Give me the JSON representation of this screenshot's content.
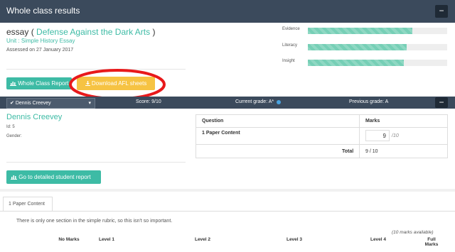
{
  "header": {
    "title": "Whole class results",
    "collapse": "−"
  },
  "assessment": {
    "type": "essay",
    "open_paren": "( ",
    "subject": "Defense Against the Dark Arts",
    "close_paren": " )",
    "unit": "Unit : Simple History Essay",
    "assessed": "Assessed on 27 January 2017"
  },
  "bars": [
    {
      "label": "Evidence",
      "value": 0.75
    },
    {
      "label": "Literacy",
      "value": 0.71
    },
    {
      "label": "Insight",
      "value": 0.69
    }
  ],
  "buttons": {
    "whole_class": "Whole Class Report",
    "download_afl": "Download AFL sheets"
  },
  "student_bar": {
    "selected_student": "Dennis Creevey",
    "score": "Score: 9/10",
    "current_grade": "Current grade: A*",
    "previous_grade": "Previous grade: A",
    "collapse": "−"
  },
  "student": {
    "name": "Dennis Creevey",
    "id": "Id: 5",
    "gender": "Gender:"
  },
  "marks_table": {
    "header_question": "Question",
    "header_marks": "Marks",
    "row_question": "1 Paper Content",
    "row_mark": "9",
    "row_total": "/10",
    "total_label": "Total",
    "total_value": "9 / 10"
  },
  "detailed_button": "Go to detailed student report",
  "tabs": [
    {
      "label": "1 Paper Content"
    }
  ],
  "rubric": {
    "note": "There is only one section in the simple rubric, so this isn't so important.",
    "available": "(10 marks available)",
    "levels": [
      "No Marks",
      "Level 1",
      "Level 2",
      "Level 3",
      "Level 4",
      "Full Marks"
    ]
  },
  "colors": {
    "header": "#3b4a5c",
    "accent": "#3dbba5",
    "bar_fill": "#76cfb6",
    "yellow": "#f6c343",
    "highlight": "#e8191b"
  }
}
